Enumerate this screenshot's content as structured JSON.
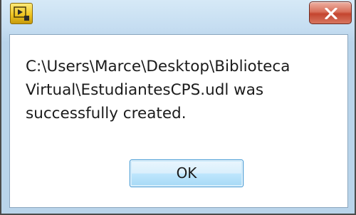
{
  "dialog": {
    "icon": "labview-run-icon",
    "close_icon": "close-x-icon",
    "message_lines": [
      "C:\\Users\\Marce\\Desktop\\Biblioteca",
      "Virtual\\EstudiantesCPS.udl was",
      "successfully created."
    ],
    "ok_label": "OK"
  },
  "colors": {
    "titlebar": "#c5ddf1",
    "close_button": "#c4452f",
    "ok_button_border": "#2f8fd0"
  }
}
